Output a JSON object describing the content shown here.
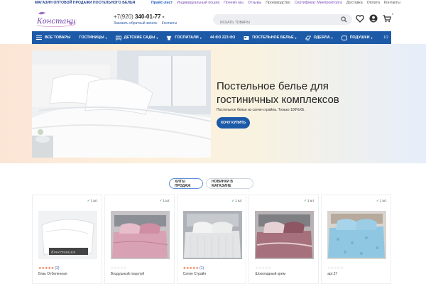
{
  "top": {
    "tagline": "МАГАЗИН ОПТОВОЙ ПРОДАЖИ ПОСТЕЛЬНОГО БЕЛЬЯ",
    "links": [
      "Прайс-лист",
      "Индивидуальный пошив",
      "Почему мы",
      "Отзывы",
      "Производство",
      "Сертификат Минпромторга",
      "Доставка",
      "Оплата",
      "Контакты"
    ]
  },
  "header": {
    "logo_text": "Констанция",
    "phone_prefix": "+7(920)",
    "phone_number": "340-01-77",
    "callback": "Заказать обратный звонок",
    "contacts": "Контакты",
    "search_placeholder": "ИСКАТЬ ТОВАРЫ",
    "cart_count": "0"
  },
  "nav": {
    "items": [
      "ВСЕ ТОВАРЫ",
      "ГОСТИНИЦЫ",
      "ДЕТСКИЕ САДЫ",
      "ГОСПИТАЛИ",
      "44 ФЗ 223 ФЗ",
      "ПОСТЕЛЬНОЕ БЕЛЬЕ",
      "ОДЕЯЛА",
      "ПОДУШКИ"
    ],
    "pager": "1/2"
  },
  "hero": {
    "title": "Постельное белье для гостиничных комплексов",
    "subtitle": "Постельное белье из сатин-страйпа. Только 100%ХБ.",
    "button": "ХОЧУ КУПИТЬ"
  },
  "tabs": [
    "ХИТЫ ПРОДАЖ",
    "НОВИНКИ В МАГАЗИНЕ"
  ],
  "products": [
    {
      "name": "Бязь Отбеленная",
      "rating": 5,
      "reviews": "(2)",
      "stock": "1 шт.",
      "color": "#e9eaec"
    },
    {
      "name": "Воздушный поцелуй",
      "rating": 0,
      "reviews": "",
      "stock": "1 шт.",
      "color": "#d9a1b4"
    },
    {
      "name": "Сатин Страйп",
      "rating": 5,
      "reviews": "(1)",
      "stock": "1 шт.",
      "color": "#d8d9dc"
    },
    {
      "name": "Шоколадный крем",
      "rating": 0,
      "reviews": "",
      "stock": "1 шт.",
      "color": "#a6707c"
    },
    {
      "name": "арт.27",
      "rating": 0,
      "reviews": "",
      "stock": "1 шт.",
      "color": "#8fc7e2"
    }
  ],
  "colors": {
    "brand_blue": "#1c5aa8",
    "star": "#e8622b",
    "stock_check": "#3aa34a"
  }
}
